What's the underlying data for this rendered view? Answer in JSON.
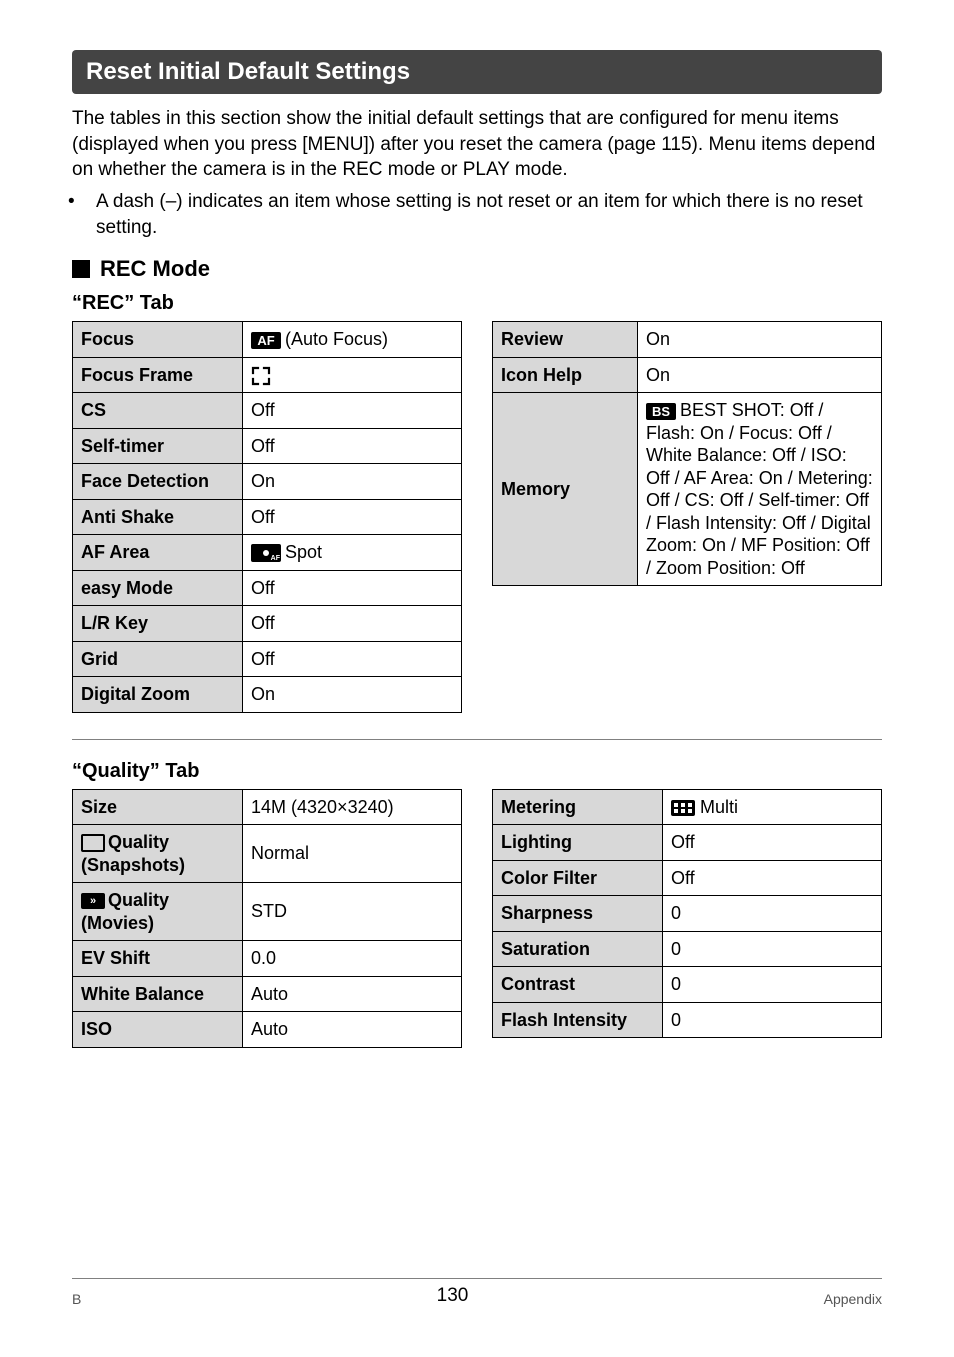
{
  "section_title": "Reset Initial Default Settings",
  "intro_lines": [
    "The tables in this section show the initial default settings that are configured for menu items (displayed when you press [MENU]) after you reset the camera (page 115). Menu items depend on whether the camera is in the REC mode or PLAY mode."
  ],
  "bullet": "A dash (–) indicates an item whose setting is not reset or an item for which there is no reset setting.",
  "rec_mode_heading": "REC Mode",
  "rec_tab_title": "“REC” Tab",
  "rec_left": [
    {
      "key": "Focus",
      "icon": "af",
      "val_text": "(Auto Focus)"
    },
    {
      "key": "Focus Frame",
      "icon": "focusframe",
      "val_text": ""
    },
    {
      "key": "CS",
      "icon": "",
      "val_text": "Off"
    },
    {
      "key": "Self-timer",
      "icon": "",
      "val_text": "Off"
    },
    {
      "key": "Face Detection",
      "icon": "",
      "val_text": "On"
    },
    {
      "key": "Anti Shake",
      "icon": "",
      "val_text": "Off"
    },
    {
      "key": "AF Area",
      "icon": "spot",
      "val_text": "Spot"
    },
    {
      "key": "easy Mode",
      "icon": "",
      "val_text": "Off"
    },
    {
      "key": "L/R Key",
      "icon": "",
      "val_text": "Off"
    },
    {
      "key": "Grid",
      "icon": "",
      "val_text": "Off"
    },
    {
      "key": "Digital Zoom",
      "icon": "",
      "val_text": "On"
    }
  ],
  "rec_right": [
    {
      "key": "Review",
      "icon": "",
      "val_text": "On"
    },
    {
      "key": "Icon Help",
      "icon": "",
      "val_text": "On"
    },
    {
      "key": "Memory",
      "icon": "bs",
      "val_text": "BEST SHOT: Off / Flash: On / Focus: Off / White Balance: Off / ISO: Off / AF Area: On / Metering: Off / CS: Off / Self-timer: Off / Flash Intensity: Off / Digital Zoom: On / MF Position: Off / Zoom Position: Off"
    }
  ],
  "quality_tab_title": "“Quality” Tab",
  "quality_left": [
    {
      "key": "Size",
      "icon_key": "",
      "val_text": "14M (4320×3240)"
    },
    {
      "key": "Quality (Snapshots)",
      "icon_key": "snapshot",
      "val_text": "Normal"
    },
    {
      "key": "Quality (Movies)",
      "icon_key": "movie",
      "val_text": "STD"
    },
    {
      "key": "EV Shift",
      "icon_key": "",
      "val_text": "0.0"
    },
    {
      "key": "White Balance",
      "icon_key": "",
      "val_text": "Auto"
    },
    {
      "key": "ISO",
      "icon_key": "",
      "val_text": "Auto"
    }
  ],
  "quality_right": [
    {
      "key": "Metering",
      "icon": "multi",
      "val_text": "Multi"
    },
    {
      "key": "Lighting",
      "icon": "",
      "val_text": "Off"
    },
    {
      "key": "Color Filter",
      "icon": "",
      "val_text": "Off"
    },
    {
      "key": "Sharpness",
      "icon": "",
      "val_text": "0"
    },
    {
      "key": "Saturation",
      "icon": "",
      "val_text": "0"
    },
    {
      "key": "Contrast",
      "icon": "",
      "val_text": "0"
    },
    {
      "key": "Flash Intensity",
      "icon": "",
      "val_text": "0"
    }
  ],
  "footer_left": "B",
  "footer_center": "130",
  "footer_right": "Appendix"
}
